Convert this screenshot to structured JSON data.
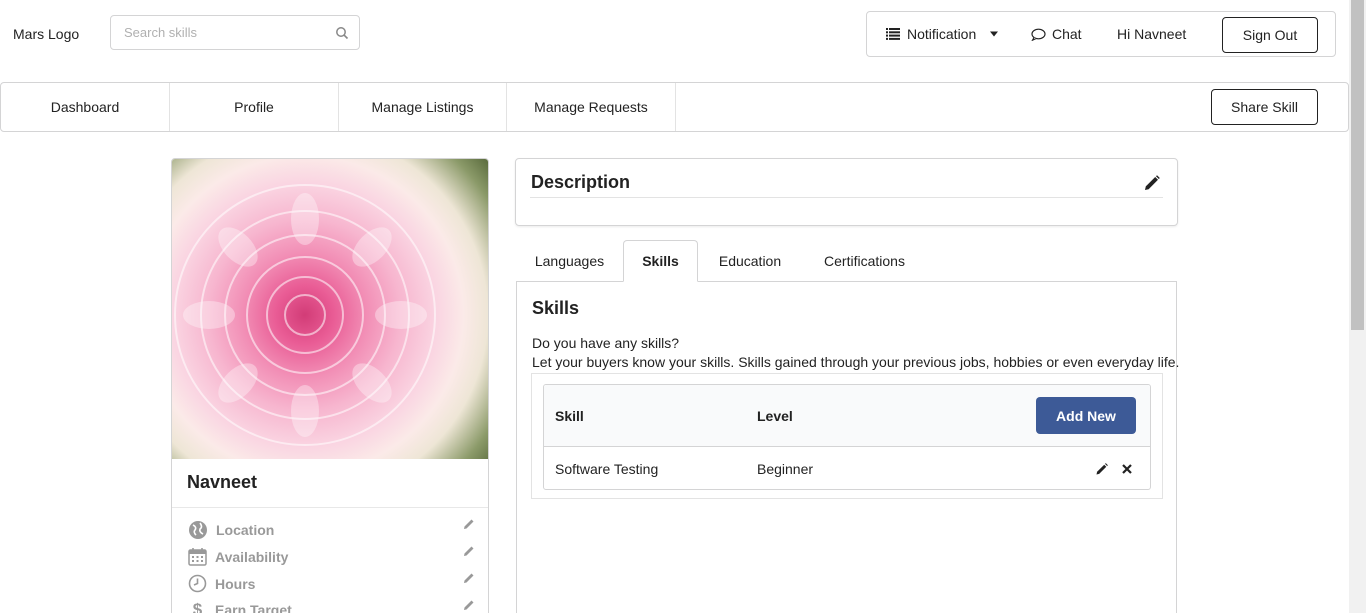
{
  "header": {
    "logo": "Mars Logo",
    "search_placeholder": "Search skills",
    "notification_label": "Notification",
    "chat_label": "Chat",
    "greeting": "Hi Navneet",
    "signout_label": "Sign Out"
  },
  "nav": {
    "items": [
      {
        "label": "Dashboard"
      },
      {
        "label": "Profile"
      },
      {
        "label": "Manage Listings"
      },
      {
        "label": "Manage Requests"
      }
    ],
    "share_label": "Share Skill"
  },
  "profile": {
    "name": "Navneet",
    "details": [
      {
        "label": "Location",
        "icon": "globe-icon"
      },
      {
        "label": "Availability",
        "icon": "calendar-icon"
      },
      {
        "label": "Hours",
        "icon": "clock-icon"
      },
      {
        "label": "Earn Target",
        "icon": "dollar-icon"
      }
    ]
  },
  "description": {
    "title": "Description"
  },
  "tabs": [
    {
      "label": "Languages"
    },
    {
      "label": "Skills",
      "active": true
    },
    {
      "label": "Education"
    },
    {
      "label": "Certifications"
    }
  ],
  "skills_panel": {
    "title": "Skills",
    "question": "Do you have any skills?",
    "subtitle": "Let your buyers know your skills. Skills gained through your previous jobs, hobbies or even everyday life.",
    "columns": {
      "skill": "Skill",
      "level": "Level"
    },
    "add_label": "Add New",
    "rows": [
      {
        "skill": "Software Testing",
        "level": "Beginner"
      }
    ]
  },
  "colors": {
    "primary_button": "#3d5a97",
    "border": "#d4d4d5"
  }
}
